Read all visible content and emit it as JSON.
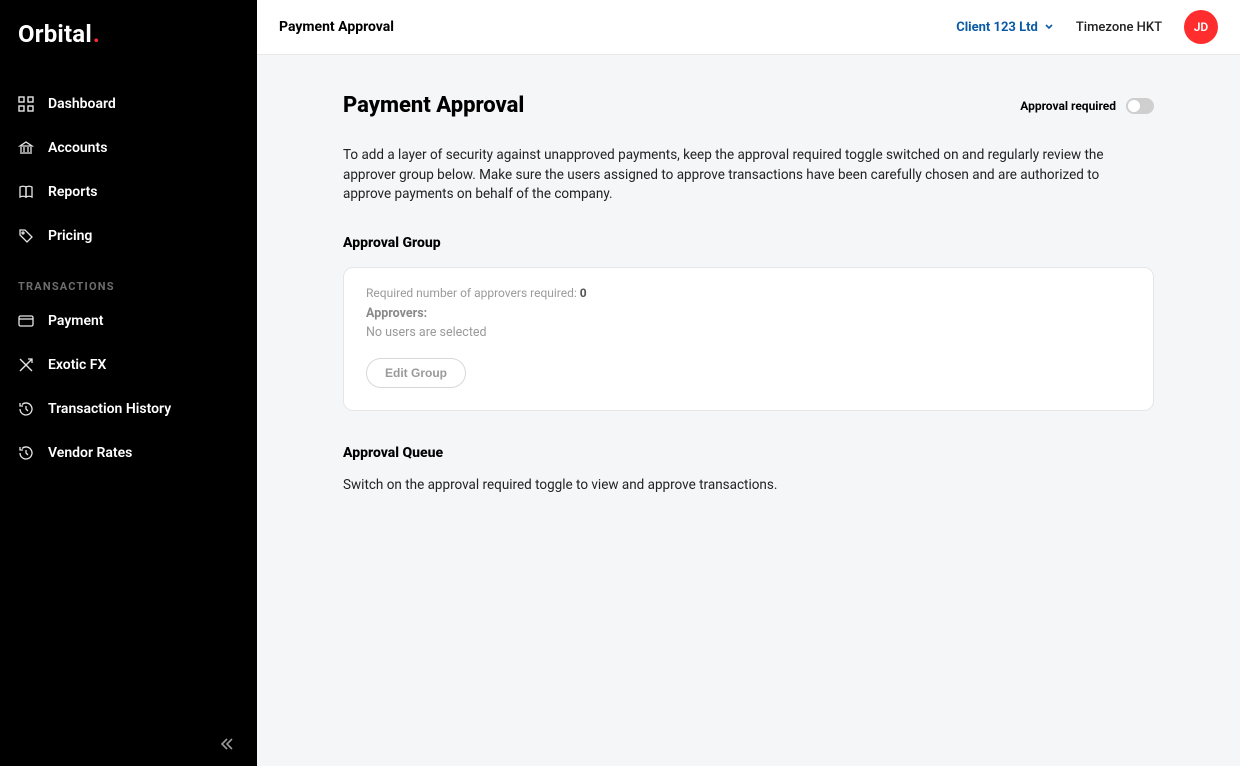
{
  "brand": {
    "name": "Orbital",
    "dot": "."
  },
  "sidebar": {
    "items": [
      {
        "label": "Dashboard"
      },
      {
        "label": "Accounts"
      },
      {
        "label": "Reports"
      },
      {
        "label": "Pricing"
      }
    ],
    "section_label": "TRANSACTIONS",
    "tx_items": [
      {
        "label": "Payment"
      },
      {
        "label": "Exotic FX"
      },
      {
        "label": "Transaction History"
      },
      {
        "label": "Vendor Rates"
      }
    ]
  },
  "topbar": {
    "title": "Payment Approval",
    "client": "Client 123 Ltd",
    "timezone": "Timezone HKT",
    "avatar_initials": "JD"
  },
  "content": {
    "heading": "Payment Approval",
    "toggle_label": "Approval required",
    "intro": "To add a layer of security against unapproved payments, keep the approval required toggle switched on and regularly review the approver group below. Make sure the users assigned to approve transactions have been carefully chosen and are authorized to approve payments on behalf of the company.",
    "group_heading": "Approval Group",
    "group": {
      "required_label": "Required number of approvers required: ",
      "required_value": "0",
      "approvers_label": "Approvers:",
      "empty_text": "No users are selected",
      "edit_button": "Edit Group"
    },
    "queue_heading": "Approval Queue",
    "queue_text": "Switch on the approval required toggle to view and approve transactions."
  }
}
